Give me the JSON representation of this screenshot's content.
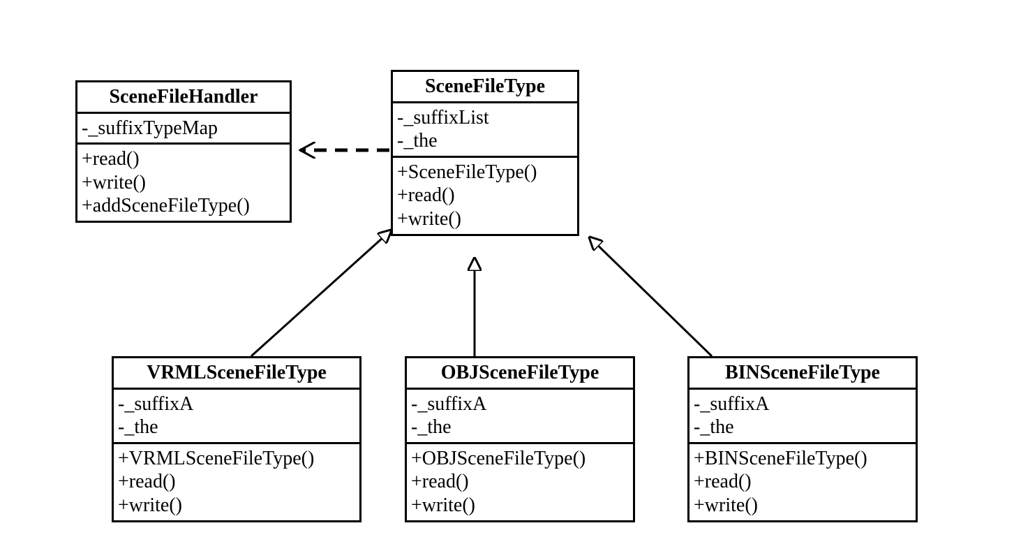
{
  "classes": {
    "handler": {
      "name": "SceneFileHandler",
      "attrs": [
        "-_suffixTypeMap"
      ],
      "ops": [
        "+read()",
        "+write()",
        "+addSceneFileType()"
      ]
    },
    "filetype": {
      "name": "SceneFileType",
      "attrs": [
        "-_suffixList",
        "-_the"
      ],
      "ops": [
        "+SceneFileType()",
        "+read()",
        "+write()"
      ]
    },
    "vrml": {
      "name": "VRMLSceneFileType",
      "attrs": [
        "-_suffixA",
        "-_the"
      ],
      "ops": [
        "+VRMLSceneFileType()",
        "+read()",
        "+write()"
      ]
    },
    "obj": {
      "name": "OBJSceneFileType",
      "attrs": [
        "-_suffixA",
        "-_the"
      ],
      "ops": [
        "+OBJSceneFileType()",
        "+read()",
        "+write()"
      ]
    },
    "bin": {
      "name": "BINSceneFileType",
      "attrs": [
        "-_suffixA",
        "-_the"
      ],
      "ops": [
        "+BINSceneFileType()",
        "+read()",
        "+write()"
      ]
    }
  }
}
